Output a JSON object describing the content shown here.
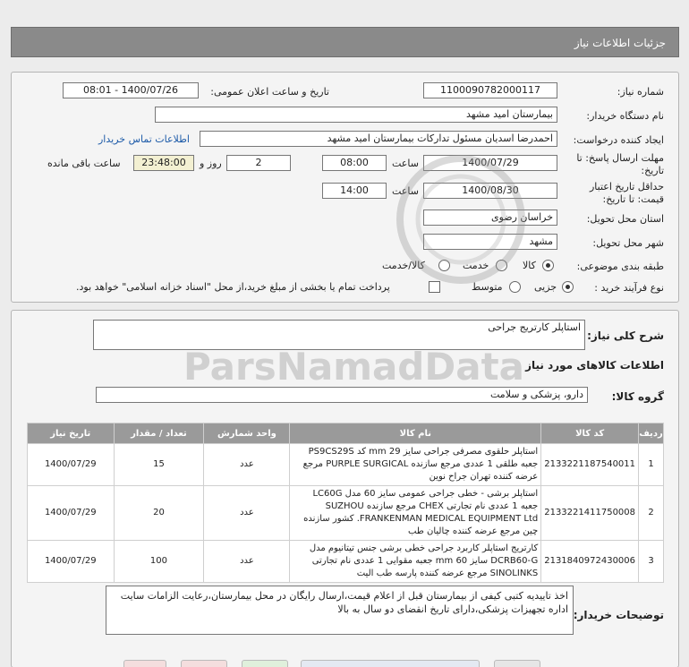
{
  "header": {
    "title": "جزئیات اطلاعات نیاز"
  },
  "form": {
    "need_number_label": "شماره نیاز:",
    "need_number": "1100090782000117",
    "announce_label": "تاریخ و ساعت اعلان عمومی:",
    "announce_value": "1400/07/26 - 08:01",
    "buyer_org_label": "نام دستگاه خریدار:",
    "buyer_org": "بیمارستان امید مشهد",
    "requester_label": "ایجاد کننده درخواست:",
    "requester": "احمدرضا اسدیان مسئول تدارکات بیمارستان امید مشهد",
    "contact_link": "اطلاعات تماس خریدار",
    "deadline_label_1": "مهلت ارسال پاسخ: تا",
    "deadline_label_2": "تاریخ:",
    "deadline_date": "1400/07/29",
    "time_label": "ساعت",
    "deadline_time": "08:00",
    "days_value": "2",
    "days_label": "روز و",
    "remaining_time": "23:48:00",
    "remaining_label": "ساعت باقی مانده",
    "validity_label_1": "حداقل تاریخ اعتبار",
    "validity_label_2": "قیمت: تا تاریخ:",
    "validity_date": "1400/08/30",
    "validity_time": "14:00",
    "province_label": "استان محل تحویل:",
    "province": "خراسان رضوی",
    "city_label": "شهر محل تحویل:",
    "city": "مشهد",
    "category_label": "طبقه بندی موضوعی:",
    "category_options": [
      "کالا",
      "خدمت",
      "کالا/خدمت"
    ],
    "process_label": "نوع فرآیند خرید :",
    "process_options": [
      "جزیی",
      "متوسط"
    ],
    "treasury_text": "پرداخت تمام یا بخشی از مبلغ خرید،از محل \"اسناد خزانه اسلامی\" خواهد بود."
  },
  "summary": {
    "general_desc_label": "شرح کلی نیاز:",
    "general_desc": "استاپلر کارتریج جراحی",
    "goods_info_title": "اطلاعات کالاهای مورد نیاز",
    "group_label": "گروه کالا:",
    "group_value": "دارو، پزشکی و سلامت"
  },
  "table": {
    "headers": [
      "ردیف",
      "کد کالا",
      "نام کالا",
      "واحد شمارش",
      "تعداد / مقدار",
      "تاریخ نیاز"
    ],
    "rows": [
      {
        "row": "1",
        "code": "2133221187540011",
        "name": "استاپلر حلقوی مصرفی جراحی سایز 29 mm کد PS9CS29S جعبه طلقی 1 عددی مرجع سازنده PURPLE SURGICAL مرجع عرضه کننده تهران جراح نوین",
        "unit": "عدد",
        "qty": "15",
        "date": "1400/07/29"
      },
      {
        "row": "2",
        "code": "2133221411750008",
        "name": "استاپلر برشی - خطی جراحی عمومی سایز 60 مدل LC60G جعبه 1 عددی نام تجارتی CHEX مرجع سازنده SUZHOU FRANKENMAN MEDICAL EQUIPMENT Ltd. کشور سازنده چین مرجع عرضه کننده چالیان طب",
        "unit": "عدد",
        "qty": "20",
        "date": "1400/07/29"
      },
      {
        "row": "3",
        "code": "2131840972430006",
        "name": "کارتریج استاپلر کاربرد جراحی خطی برشی جنس تیتانیوم مدل DCRB60-G سایز 60 mm جعبه مقوایی 1 عددی نام تجارتی SINOLINKS مرجع عرضه کننده پارسه طب الیت",
        "unit": "عدد",
        "qty": "100",
        "date": "1400/07/29"
      }
    ]
  },
  "buyer_notes": {
    "label": "توضیحات خریدار:",
    "text": "اخذ تاییدیه کتبی کیفی از بیمارستان قبل از اعلام قیمت،ارسال رایگان در محل بیمارستان،رعایت الزامات سایت اداره تجهیزات پزشکی،دارای تاریخ انقضای دو سال به بالا"
  },
  "watermark": {
    "brand": "ParsNamadData"
  }
}
